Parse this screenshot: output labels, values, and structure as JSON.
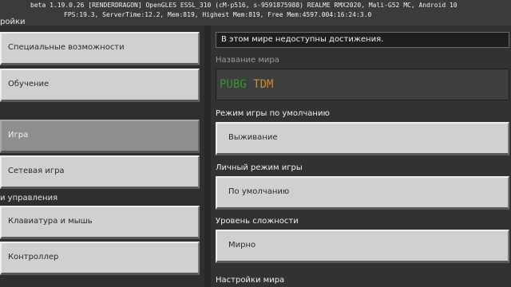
{
  "debug": {
    "line1": "beta 1.19.0.26 [RENDERDRAGON] OpenGLES ESSL_310 (cM-p516, s-9591875988) REALME RMX2020, Mali-G52 MC, Android 10",
    "line2": "FPS:19.3, ServerTime:12.2, Mem:819, Highest Mem:819, Free Mem:4597.004:16:24:3.0"
  },
  "window": {
    "title": "ройки"
  },
  "sidebar": {
    "items": [
      {
        "label": "Специальные возможности",
        "selected": false
      },
      {
        "label": "Обучение",
        "selected": false
      },
      {
        "label": "Игра",
        "selected": true
      },
      {
        "label": "Сетевая игра",
        "selected": false
      },
      {
        "label": "Клавиатура и мышь",
        "selected": false
      },
      {
        "label": "Контроллер",
        "selected": false
      }
    ],
    "section_controls": "и управления"
  },
  "main": {
    "notice": "В этом мире недоступны достижения.",
    "world_name_label": "Название мира",
    "world_name_part1": "PUBG",
    "world_name_part2": "TDM",
    "gamemode_label": "Режим игры по умолчанию",
    "gamemode_value": "Выживание",
    "personal_mode_label": "Личный режим игры",
    "personal_mode_value": "По умолчанию",
    "difficulty_label": "Уровень сложности",
    "difficulty_value": "Мирно",
    "world_settings_label": "Настройки мира"
  },
  "colors": {
    "world_name_part1": "#2f9b2f",
    "world_name_part2": "#d68c1a"
  }
}
